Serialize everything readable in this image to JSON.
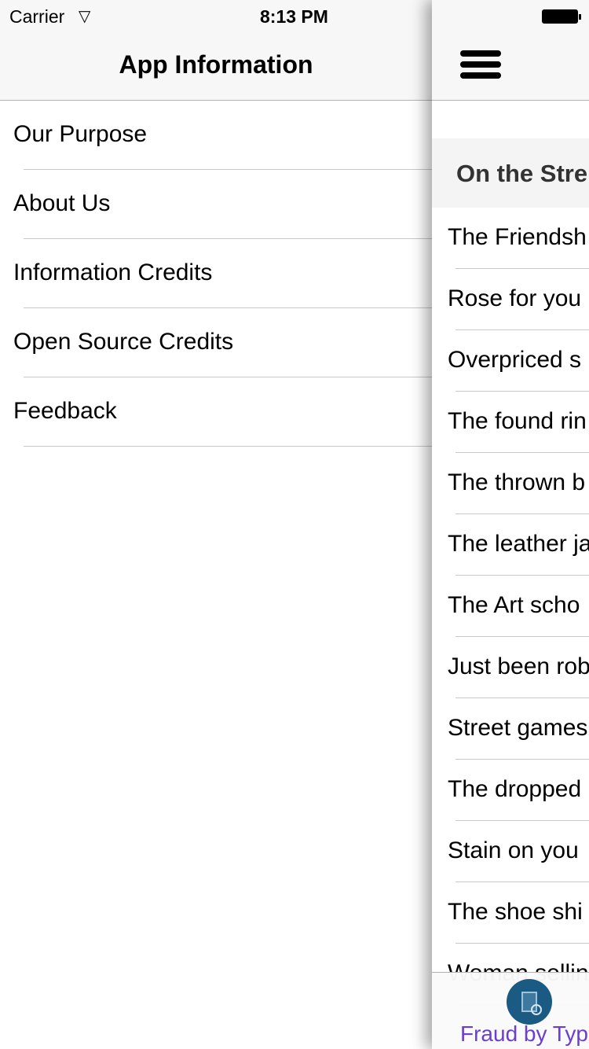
{
  "status_bar": {
    "carrier": "Carrier",
    "time": "8:13 PM"
  },
  "menu": {
    "title": "App Information",
    "items": [
      {
        "label": "Our Purpose"
      },
      {
        "label": "About Us"
      },
      {
        "label": "Information Credits"
      },
      {
        "label": "Open Source Credits"
      },
      {
        "label": "Feedback"
      }
    ]
  },
  "main": {
    "section_header": "On the Stre",
    "rows": [
      {
        "label": "The Friendsh"
      },
      {
        "label": "Rose for you"
      },
      {
        "label": "Overpriced s"
      },
      {
        "label": "The found rin"
      },
      {
        "label": "The thrown b"
      },
      {
        "label": "The leather ja"
      },
      {
        "label": "The Art scho"
      },
      {
        "label": "Just been rob"
      },
      {
        "label": "Street games"
      },
      {
        "label": "The dropped"
      },
      {
        "label": "Stain on you"
      },
      {
        "label": "The shoe shi"
      },
      {
        "label": "Woman sellin"
      }
    ],
    "tab": {
      "label": "Fraud by Type",
      "icon": "document-search-icon",
      "color": "#6a3fd0"
    }
  }
}
